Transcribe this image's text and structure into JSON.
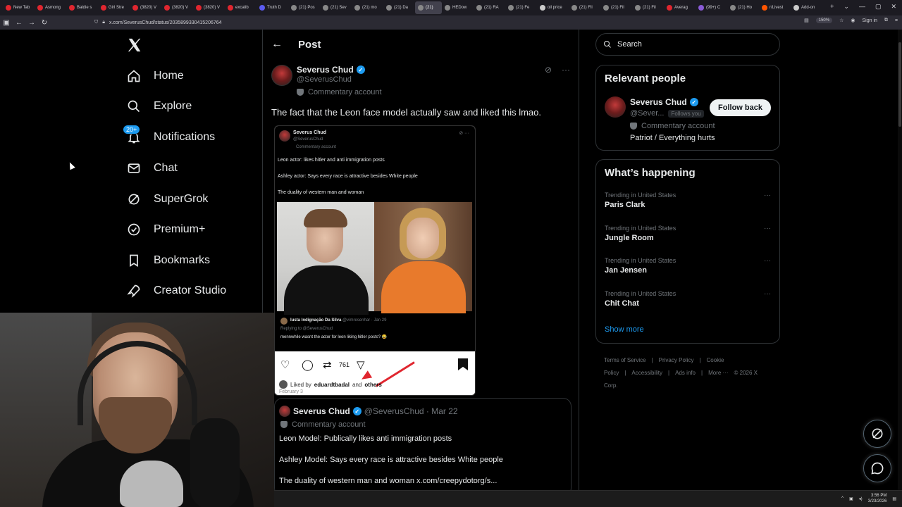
{
  "browser": {
    "tabs": [
      {
        "label": "New Tab",
        "color": "#e0262f"
      },
      {
        "label": "Asmong",
        "color": "#e0262f"
      },
      {
        "label": "Baldie s",
        "color": "#e0262f"
      },
      {
        "label": "Girl Stre",
        "color": "#e0262f"
      },
      {
        "label": "(3820) V",
        "color": "#e0262f"
      },
      {
        "label": "(3820) V",
        "color": "#e0262f"
      },
      {
        "label": "(3820) V",
        "color": "#e0262f"
      },
      {
        "label": "excalib",
        "color": "#e0262f"
      },
      {
        "label": "Truth D",
        "color": "#5b5bf0"
      },
      {
        "label": "(21) Pos",
        "color": "#888888"
      },
      {
        "label": "(21) Sev",
        "color": "#888888"
      },
      {
        "label": "(21) mo",
        "color": "#888888"
      },
      {
        "label": "(21) Da",
        "color": "#888888"
      },
      {
        "label": "(21)",
        "color": "#888888",
        "active": true
      },
      {
        "label": "HEDow",
        "color": "#888888"
      },
      {
        "label": "(21) RA",
        "color": "#888888"
      },
      {
        "label": "(21) Fe",
        "color": "#888888"
      },
      {
        "label": "oil price",
        "color": "#cccccc"
      },
      {
        "label": "(21) Fil",
        "color": "#888888"
      },
      {
        "label": "(21) Fil",
        "color": "#888888"
      },
      {
        "label": "(21) Fil",
        "color": "#888888"
      },
      {
        "label": "Averag",
        "color": "#e0262f"
      },
      {
        "label": "(99+) C",
        "color": "#8a5bd6"
      },
      {
        "label": "(21) Ho",
        "color": "#888888"
      },
      {
        "label": "r/Livest",
        "color": "#ff5500"
      },
      {
        "label": "Add-on",
        "color": "#cccccc"
      }
    ],
    "new_tab": "+",
    "dropdown": "⌄",
    "win_min": "—",
    "win_max": "▢",
    "win_close": "✕",
    "url": "x.com/SeverusChud/status/2035899330415206764",
    "zoom": "150%",
    "sign_in": "Sign in"
  },
  "nav": {
    "items": [
      {
        "label": "Home",
        "icon": "home-icon"
      },
      {
        "label": "Explore",
        "icon": "search-icon"
      },
      {
        "label": "Notifications",
        "icon": "bell-icon",
        "badge": "20+"
      },
      {
        "label": "Chat",
        "icon": "mail-icon"
      },
      {
        "label": "SuperGrok",
        "icon": "grok-icon"
      },
      {
        "label": "Premium+",
        "icon": "verified-icon"
      },
      {
        "label": "Bookmarks",
        "icon": "bookmark-icon"
      },
      {
        "label": "Creator Studio",
        "icon": "rocket-icon"
      }
    ]
  },
  "post": {
    "title": "Post",
    "author_name": "Severus Chud",
    "author_handle": "@SeverusChud",
    "commentary": "Commentary account",
    "text": "The fact that the Leon face model actually saw and liked this lmao."
  },
  "embed": {
    "name": "Severus Chud",
    "handle": "@SeverusChud",
    "commentary": "Commentary account",
    "line1": "Leon actor: likes hitler and anti immigration posts",
    "line2": "Ashley actor: Says every race is attractive besides White people",
    "line3": "The duality of western man and woman",
    "reply_name": "Iusta Indignação Da Silva",
    "reply_meta": "@vimresenhar · Jan 29",
    "reply_to": "Replying to @SeverusChud",
    "reply_text": "mennwhile wasnt the actor for leon liking hitler posts? 😂",
    "retweets": "761",
    "liked_prefix": "Liked by",
    "liked_user": "eduardtbadal",
    "liked_and": "and",
    "liked_others": "others",
    "date": "February 3"
  },
  "quote": {
    "name": "Severus Chud",
    "handle_date": "@SeverusChud · Mar 22",
    "commentary": "Commentary account",
    "line1": "Leon Model: Publically likes anti immigration posts",
    "line2": "Ashley Model: Says every race is attractive besides White people",
    "line3": "The duality of western man and woman  x.com/creepydotorg/s..."
  },
  "sidebar": {
    "search_placeholder": "Search",
    "relevant_title": "Relevant people",
    "rp_name": "Severus Chud",
    "rp_handle": "@Sever...",
    "follows_you": "Follows you",
    "follow_back": "Follow back",
    "rp_commentary": "Commentary account",
    "rp_bio": "Patriot / Everything hurts",
    "happening_title": "What’s happening",
    "trends": [
      {
        "context": "Trending in United States",
        "name": "Paris Clark"
      },
      {
        "context": "Trending in United States",
        "name": "Jungle Room"
      },
      {
        "context": "Trending in United States",
        "name": "Jan Jensen"
      },
      {
        "context": "Trending in United States",
        "name": "Chit Chat"
      }
    ],
    "show_more": "Show more",
    "footer": [
      "Terms of Service",
      "|",
      "Privacy Policy",
      "|",
      "Cookie Policy",
      "|",
      "Accessibility",
      "|",
      "Ads info",
      "|",
      "More ···",
      "© 2026 X Corp."
    ]
  },
  "taskbar": {
    "time": "3:56 PM",
    "date": "3/23/2026"
  },
  "colors": {
    "accent": "#1d9bf0",
    "annotation_red": "#e0262f"
  }
}
